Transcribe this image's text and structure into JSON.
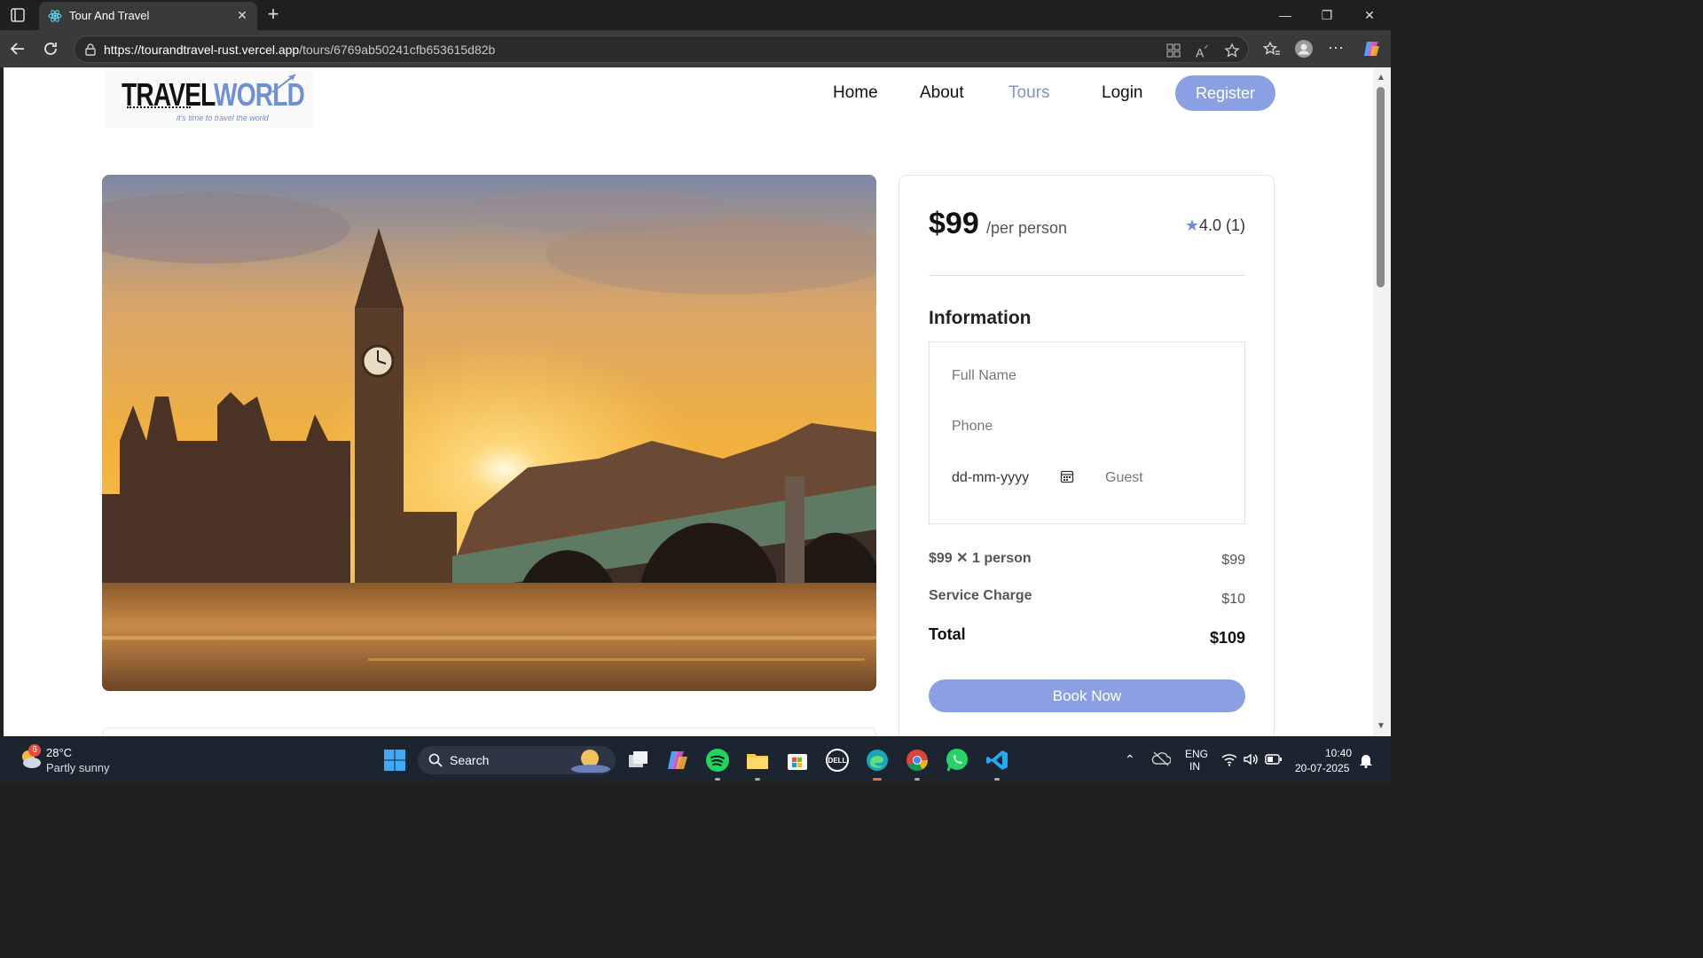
{
  "browser": {
    "tab_title": "Tour And Travel",
    "url_host": "https://tourandtravel-rust.vercel.app",
    "url_path": "/tours/6769ab50241cfb653615d82b"
  },
  "site": {
    "logo_text_a": "TRAVEL",
    "logo_text_b": "WORLD",
    "logo_tagline": "it's time to travel the world",
    "nav": {
      "home": "Home",
      "about": "About",
      "tours": "Tours",
      "login": "Login",
      "register": "Register"
    }
  },
  "booking": {
    "price": "$99",
    "per_person": "/per person",
    "rating": "4.0 (1)",
    "info_title": "Information",
    "full_name_placeholder": "Full Name",
    "phone_placeholder": "Phone",
    "date_placeholder": "dd-mm-yyyy",
    "guest_placeholder": "Guest",
    "line_item_label": "$99 ✕ 1 person",
    "line_item_value": "$99",
    "service_label": "Service Charge",
    "service_value": "$10",
    "total_label": "Total",
    "total_value": "$109",
    "book_now": "Book Now"
  },
  "colors": {
    "accent": "#8aa0e2",
    "active_nav": "#7b93d6"
  },
  "taskbar": {
    "temperature": "28°C",
    "condition": "Partly sunny",
    "weather_badge": "6",
    "search_label": "Search",
    "lang_1": "ENG",
    "lang_2": "IN",
    "time": "10:40",
    "date": "20-07-2025"
  }
}
